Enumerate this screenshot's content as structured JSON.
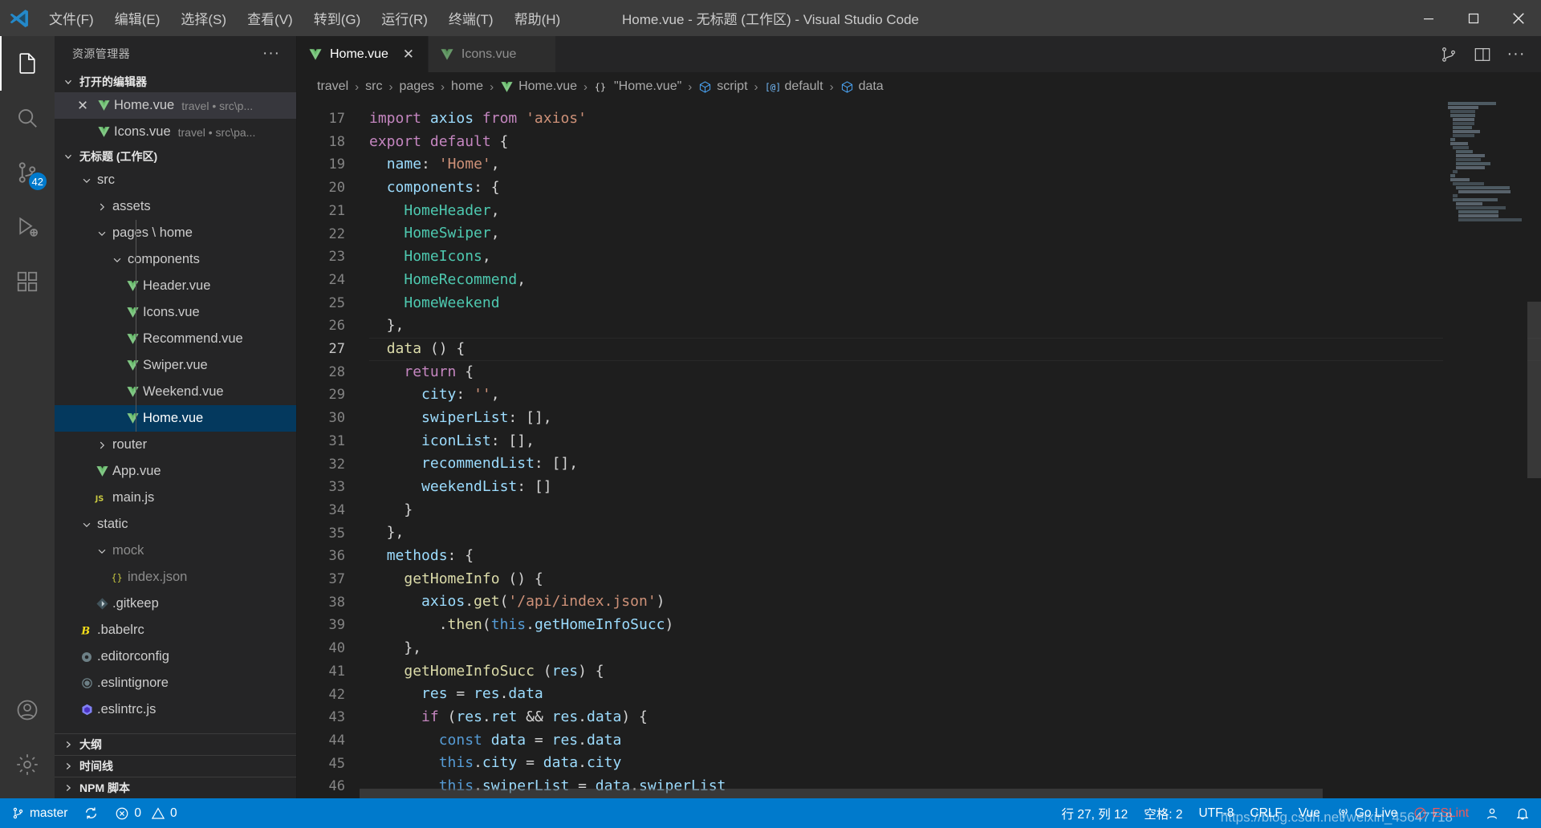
{
  "window": {
    "title": "Home.vue - 无标题 (工作区) - Visual Studio Code",
    "minimize": "—",
    "maximize": "□",
    "close": "✕"
  },
  "menu": {
    "items": [
      {
        "label": "文件(F)"
      },
      {
        "label": "编辑(E)"
      },
      {
        "label": "选择(S)"
      },
      {
        "label": "查看(V)"
      },
      {
        "label": "转到(G)"
      },
      {
        "label": "运行(R)"
      },
      {
        "label": "终端(T)"
      },
      {
        "label": "帮助(H)"
      }
    ]
  },
  "activitybar": {
    "items": [
      {
        "name": "explorer",
        "icon": "files-icon",
        "active": true,
        "badge": ""
      },
      {
        "name": "search",
        "icon": "search-icon",
        "active": false,
        "badge": ""
      },
      {
        "name": "source-control",
        "icon": "source-control-icon",
        "active": false,
        "badge": "42"
      },
      {
        "name": "run-debug",
        "icon": "run-debug-icon",
        "active": false,
        "badge": ""
      },
      {
        "name": "extensions",
        "icon": "extensions-icon",
        "active": false,
        "badge": ""
      }
    ],
    "bottom": [
      {
        "name": "accounts",
        "icon": "account-icon"
      },
      {
        "name": "settings",
        "icon": "gear-icon"
      }
    ]
  },
  "sidebar": {
    "title": "资源管理器",
    "more_actions": "···",
    "open_editors": {
      "label": "打开的编辑器",
      "items": [
        {
          "name": "Home.vue",
          "detail": "travel • src\\p...",
          "icon": "vue-icon",
          "active": true,
          "close": "✕"
        },
        {
          "name": "Icons.vue",
          "detail": "travel • src\\pa...",
          "icon": "vue-icon",
          "active": false,
          "close": ""
        }
      ]
    },
    "workspace": {
      "label": "无标题 (工作区)",
      "tree": [
        {
          "label": "src",
          "type": "folder",
          "state": "expanded",
          "depth": 1
        },
        {
          "label": "assets",
          "type": "folder",
          "state": "collapsed",
          "depth": 2
        },
        {
          "label": "pages \\ home",
          "type": "folder",
          "state": "expanded",
          "depth": 2
        },
        {
          "label": "components",
          "type": "folder",
          "state": "expanded",
          "depth": 3
        },
        {
          "label": "Header.vue",
          "type": "vue",
          "depth": 4
        },
        {
          "label": "Icons.vue",
          "type": "vue",
          "depth": 4
        },
        {
          "label": "Recommend.vue",
          "type": "vue",
          "depth": 4
        },
        {
          "label": "Swiper.vue",
          "type": "vue",
          "depth": 4
        },
        {
          "label": "Weekend.vue",
          "type": "vue",
          "depth": 4
        },
        {
          "label": "Home.vue",
          "type": "vue",
          "depth": 4,
          "selected": true
        },
        {
          "label": "router",
          "type": "folder",
          "state": "collapsed",
          "depth": 2
        },
        {
          "label": "App.vue",
          "type": "vue",
          "depth": 2
        },
        {
          "label": "main.js",
          "type": "js",
          "depth": 2
        },
        {
          "label": "static",
          "type": "folder",
          "state": "expanded",
          "depth": 1
        },
        {
          "label": "mock",
          "type": "folder",
          "state": "expanded",
          "depth": 2,
          "dim": true
        },
        {
          "label": "index.json",
          "type": "json",
          "depth": 3,
          "dim": true
        },
        {
          "label": ".gitkeep",
          "type": "git",
          "depth": 2
        },
        {
          "label": ".babelrc",
          "type": "babel",
          "depth": 1
        },
        {
          "label": ".editorconfig",
          "type": "editorconfig",
          "depth": 1
        },
        {
          "label": ".eslintignore",
          "type": "eslint-ignore",
          "depth": 1
        },
        {
          "label": ".eslintrc.js",
          "type": "eslint",
          "depth": 1
        }
      ]
    },
    "bottom_sections": [
      {
        "label": "大纲"
      },
      {
        "label": "时间线"
      },
      {
        "label": "NPM 脚本"
      }
    ]
  },
  "editor": {
    "tabs": [
      {
        "label": "Home.vue",
        "icon": "vue-icon",
        "active": true,
        "close": "✕"
      },
      {
        "label": "Icons.vue",
        "icon": "vue-icon",
        "active": false,
        "close": ""
      }
    ],
    "tab_actions": [
      {
        "name": "split-editor-right",
        "icon": "split-editor-icon"
      },
      {
        "name": "toggle-panel",
        "icon": "layout-panel-icon"
      },
      {
        "name": "more-actions",
        "icon": "ellipsis-icon",
        "label": "···"
      }
    ],
    "breadcrumb": [
      {
        "label": "travel",
        "icon": ""
      },
      {
        "label": "src",
        "icon": ""
      },
      {
        "label": "pages",
        "icon": ""
      },
      {
        "label": "home",
        "icon": ""
      },
      {
        "label": "Home.vue",
        "icon": "vue-icon"
      },
      {
        "label": "\"Home.vue\"",
        "icon": "json-braces-icon"
      },
      {
        "label": "script",
        "icon": "module-icon"
      },
      {
        "label": "default",
        "icon": "variable-icon"
      },
      {
        "label": "data",
        "icon": "module-icon"
      }
    ],
    "breadcrumb_separator": "›",
    "code": {
      "first_line": 17,
      "current_line": 27,
      "lines": [
        {
          "n": 17,
          "tokens": [
            [
              "tok-kw2",
              "import "
            ],
            [
              "tok-var",
              "axios"
            ],
            [
              "tok-plain",
              " "
            ],
            [
              "tok-kw2",
              "from"
            ],
            [
              "tok-plain",
              " "
            ],
            [
              "tok-str",
              "'axios'"
            ]
          ]
        },
        {
          "n": 18,
          "tokens": [
            [
              "tok-kw2",
              "export "
            ],
            [
              "tok-kw2",
              "default"
            ],
            [
              "tok-plain",
              " {"
            ]
          ]
        },
        {
          "n": 19,
          "tokens": [
            [
              "tok-plain",
              "  "
            ],
            [
              "tok-prop",
              "name"
            ],
            [
              "tok-plain",
              ": "
            ],
            [
              "tok-str",
              "'Home'"
            ],
            [
              "tok-plain",
              ","
            ]
          ]
        },
        {
          "n": 20,
          "tokens": [
            [
              "tok-plain",
              "  "
            ],
            [
              "tok-prop",
              "components"
            ],
            [
              "tok-plain",
              ": {"
            ]
          ]
        },
        {
          "n": 21,
          "tokens": [
            [
              "tok-plain",
              "    "
            ],
            [
              "tok-cls",
              "HomeHeader"
            ],
            [
              "tok-plain",
              ","
            ]
          ]
        },
        {
          "n": 22,
          "tokens": [
            [
              "tok-plain",
              "    "
            ],
            [
              "tok-cls",
              "HomeSwiper"
            ],
            [
              "tok-plain",
              ","
            ]
          ]
        },
        {
          "n": 23,
          "tokens": [
            [
              "tok-plain",
              "    "
            ],
            [
              "tok-cls",
              "HomeIcons"
            ],
            [
              "tok-plain",
              ","
            ]
          ]
        },
        {
          "n": 24,
          "tokens": [
            [
              "tok-plain",
              "    "
            ],
            [
              "tok-cls",
              "HomeRecommend"
            ],
            [
              "tok-plain",
              ","
            ]
          ]
        },
        {
          "n": 25,
          "tokens": [
            [
              "tok-plain",
              "    "
            ],
            [
              "tok-cls",
              "HomeWeekend"
            ]
          ]
        },
        {
          "n": 26,
          "tokens": [
            [
              "tok-plain",
              "  },"
            ]
          ]
        },
        {
          "n": 27,
          "tokens": [
            [
              "tok-plain",
              "  "
            ],
            [
              "tok-fn",
              "data"
            ],
            [
              "tok-plain",
              " () {"
            ]
          ],
          "current": true
        },
        {
          "n": 28,
          "tokens": [
            [
              "tok-plain",
              "    "
            ],
            [
              "tok-kw2",
              "return"
            ],
            [
              "tok-plain",
              " {"
            ]
          ]
        },
        {
          "n": 29,
          "tokens": [
            [
              "tok-plain",
              "      "
            ],
            [
              "tok-prop",
              "city"
            ],
            [
              "tok-plain",
              ": "
            ],
            [
              "tok-str",
              "''"
            ],
            [
              "tok-plain",
              ","
            ]
          ]
        },
        {
          "n": 30,
          "tokens": [
            [
              "tok-plain",
              "      "
            ],
            [
              "tok-prop",
              "swiperList"
            ],
            [
              "tok-plain",
              ": [],"
            ]
          ]
        },
        {
          "n": 31,
          "tokens": [
            [
              "tok-plain",
              "      "
            ],
            [
              "tok-prop",
              "iconList"
            ],
            [
              "tok-plain",
              ": [],"
            ]
          ]
        },
        {
          "n": 32,
          "tokens": [
            [
              "tok-plain",
              "      "
            ],
            [
              "tok-prop",
              "recommendList"
            ],
            [
              "tok-plain",
              ": [],"
            ]
          ]
        },
        {
          "n": 33,
          "tokens": [
            [
              "tok-plain",
              "      "
            ],
            [
              "tok-prop",
              "weekendList"
            ],
            [
              "tok-plain",
              ": []"
            ]
          ]
        },
        {
          "n": 34,
          "tokens": [
            [
              "tok-plain",
              "    }"
            ]
          ]
        },
        {
          "n": 35,
          "tokens": [
            [
              "tok-plain",
              "  },"
            ]
          ]
        },
        {
          "n": 36,
          "tokens": [
            [
              "tok-plain",
              "  "
            ],
            [
              "tok-prop",
              "methods"
            ],
            [
              "tok-plain",
              ": {"
            ]
          ]
        },
        {
          "n": 37,
          "tokens": [
            [
              "tok-plain",
              "    "
            ],
            [
              "tok-fn",
              "getHomeInfo"
            ],
            [
              "tok-plain",
              " () {"
            ]
          ]
        },
        {
          "n": 38,
          "tokens": [
            [
              "tok-plain",
              "      "
            ],
            [
              "tok-var",
              "axios"
            ],
            [
              "tok-plain",
              "."
            ],
            [
              "tok-fn",
              "get"
            ],
            [
              "tok-plain",
              "("
            ],
            [
              "tok-str",
              "'/api/index.json'"
            ],
            [
              "tok-plain",
              ")"
            ]
          ]
        },
        {
          "n": 39,
          "tokens": [
            [
              "tok-plain",
              "        ."
            ],
            [
              "tok-fn",
              "then"
            ],
            [
              "tok-plain",
              "("
            ],
            [
              "tok-kw",
              "this"
            ],
            [
              "tok-plain",
              "."
            ],
            [
              "tok-var",
              "getHomeInfoSucc"
            ],
            [
              "tok-plain",
              ")"
            ]
          ]
        },
        {
          "n": 40,
          "tokens": [
            [
              "tok-plain",
              "    },"
            ]
          ]
        },
        {
          "n": 41,
          "tokens": [
            [
              "tok-plain",
              "    "
            ],
            [
              "tok-fn",
              "getHomeInfoSucc"
            ],
            [
              "tok-plain",
              " ("
            ],
            [
              "tok-var",
              "res"
            ],
            [
              "tok-plain",
              ") {"
            ]
          ]
        },
        {
          "n": 42,
          "tokens": [
            [
              "tok-plain",
              "      "
            ],
            [
              "tok-var",
              "res"
            ],
            [
              "tok-plain",
              " = "
            ],
            [
              "tok-var",
              "res"
            ],
            [
              "tok-plain",
              "."
            ],
            [
              "tok-var",
              "data"
            ]
          ]
        },
        {
          "n": 43,
          "tokens": [
            [
              "tok-plain",
              "      "
            ],
            [
              "tok-kw2",
              "if"
            ],
            [
              "tok-plain",
              " ("
            ],
            [
              "tok-var",
              "res"
            ],
            [
              "tok-plain",
              "."
            ],
            [
              "tok-var",
              "ret"
            ],
            [
              "tok-plain",
              " && "
            ],
            [
              "tok-var",
              "res"
            ],
            [
              "tok-plain",
              "."
            ],
            [
              "tok-var",
              "data"
            ],
            [
              "tok-plain",
              ") {"
            ]
          ]
        },
        {
          "n": 44,
          "tokens": [
            [
              "tok-plain",
              "        "
            ],
            [
              "tok-kw",
              "const"
            ],
            [
              "tok-plain",
              " "
            ],
            [
              "tok-var",
              "data"
            ],
            [
              "tok-plain",
              " = "
            ],
            [
              "tok-var",
              "res"
            ],
            [
              "tok-plain",
              "."
            ],
            [
              "tok-var",
              "data"
            ]
          ]
        },
        {
          "n": 45,
          "tokens": [
            [
              "tok-plain",
              "        "
            ],
            [
              "tok-kw",
              "this"
            ],
            [
              "tok-plain",
              "."
            ],
            [
              "tok-var",
              "city"
            ],
            [
              "tok-plain",
              " = "
            ],
            [
              "tok-var",
              "data"
            ],
            [
              "tok-plain",
              "."
            ],
            [
              "tok-var",
              "city"
            ]
          ]
        },
        {
          "n": 46,
          "tokens": [
            [
              "tok-plain",
              "        "
            ],
            [
              "tok-kw",
              "this"
            ],
            [
              "tok-plain",
              "."
            ],
            [
              "tok-var",
              "swiperList"
            ],
            [
              "tok-plain",
              " = "
            ],
            [
              "tok-var",
              "data"
            ],
            [
              "tok-plain",
              "."
            ],
            [
              "tok-var",
              "swiperList"
            ]
          ]
        }
      ]
    },
    "annotation": {
      "type": "arrow",
      "color": "#ee1c25",
      "points": "from (940,470) to (712,545)"
    }
  },
  "statusbar": {
    "left": [
      {
        "name": "branch",
        "icon": "source-control-icon",
        "label": "master"
      },
      {
        "name": "sync",
        "icon": "sync-icon",
        "label": ""
      },
      {
        "name": "problems",
        "icon": "error-warning-icon",
        "label": "0  0",
        "errors": "0",
        "warnings": "0"
      }
    ],
    "right": [
      {
        "name": "cursor-position",
        "label": "行 27, 列 12"
      },
      {
        "name": "indentation",
        "label": "空格: 2"
      },
      {
        "name": "encoding",
        "label": "UTF-8"
      },
      {
        "name": "eol",
        "label": "CRLF"
      },
      {
        "name": "language-mode",
        "label": "Vue"
      },
      {
        "name": "go-live",
        "label": "Go Live",
        "icon": "broadcast-icon"
      },
      {
        "name": "eslint",
        "label": "ESLint",
        "icon": "eslint-icon"
      },
      {
        "name": "accounts",
        "label": "",
        "icon": "account-icon"
      },
      {
        "name": "notifications",
        "label": "",
        "icon": "bell-icon"
      }
    ],
    "watermark": "https://blog.csdn.net/weixin_45647718",
    "accent_color": "#007acc"
  }
}
